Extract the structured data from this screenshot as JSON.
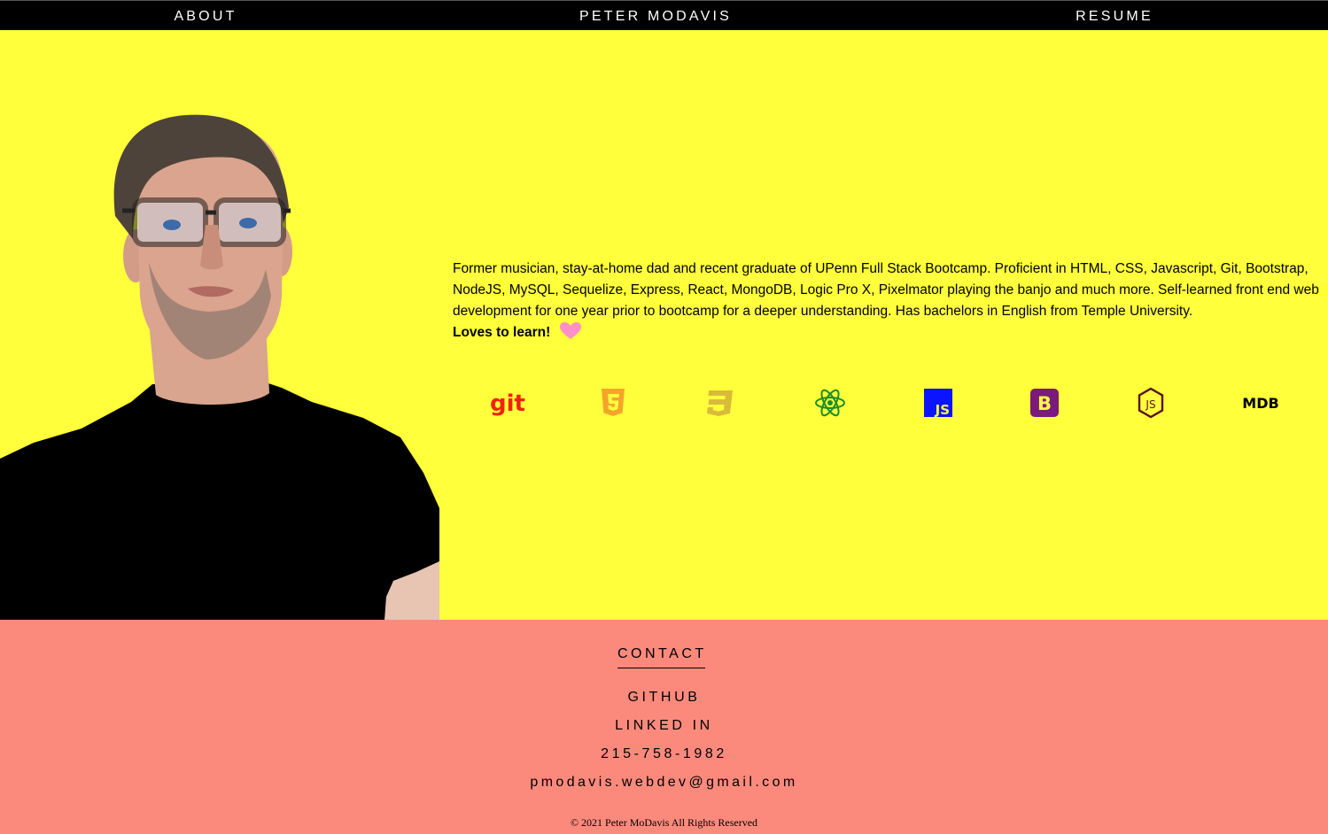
{
  "nav": {
    "about": "ABOUT",
    "name": "PETER MODAVIS",
    "resume": "RESUME"
  },
  "hero": {
    "bio": "Former musician, stay-at-home dad and recent graduate of UPenn Full Stack Bootcamp. Proficient in HTML, CSS, Javascript, Git, Bootstrap, NodeJS, MySQL, Sequelize, Express, React, MongoDB, Logic Pro X, Pixelmator playing the banjo and much more. Self-learned front end web development for one year prior to bootcamp for a deeper understanding. Has bachelors in English from Temple University.",
    "tagline": "Loves to learn!",
    "heart_color": "#ff8fc8",
    "background": "#ffff3b",
    "tech_icons": [
      {
        "name": "git-icon",
        "label": "git",
        "color": "#f0220e"
      },
      {
        "name": "html5-icon",
        "color": "#f5a42b"
      },
      {
        "name": "css3-icon",
        "color": "#d9bb3a"
      },
      {
        "name": "react-icon",
        "color": "#1a8d2a"
      },
      {
        "name": "javascript-icon",
        "label": "JS",
        "color": "#0a14ff"
      },
      {
        "name": "bootstrap-icon",
        "label": "B",
        "color": "#7a1a7a"
      },
      {
        "name": "nodejs-icon",
        "label": "JS",
        "color": "#5a1020"
      },
      {
        "name": "mdb-icon",
        "label": "MDB",
        "color": "#000000"
      }
    ]
  },
  "footer": {
    "heading": "CONTACT",
    "github": "GITHUB",
    "linkedin": "LINKED IN",
    "phone": "215-758-1982",
    "email": "pmodavis.webdev@gmail.com",
    "copyright": "© 2021 Peter MoDavis All Rights Reserved",
    "background": "#fc8a7c"
  }
}
